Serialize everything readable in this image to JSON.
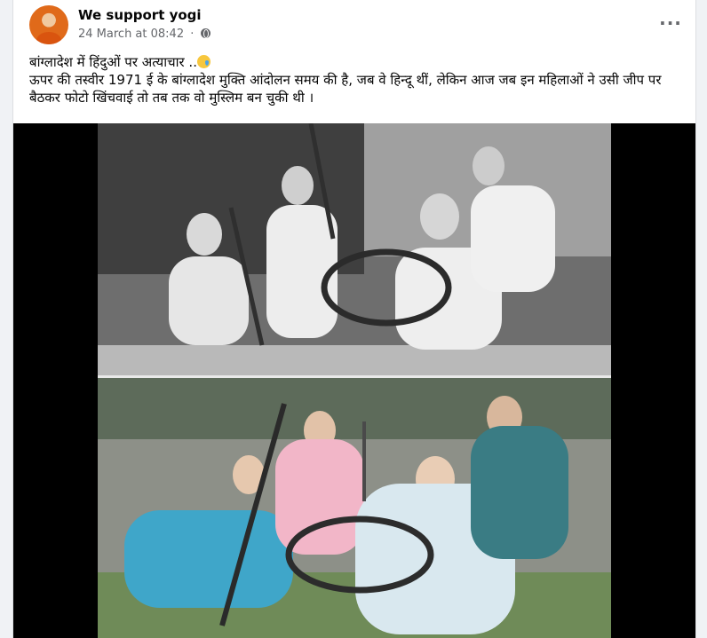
{
  "post": {
    "page_name": "We support yogi",
    "timestamp": "24 March at 08:42",
    "separator": "·",
    "privacy_icon": "globe-icon",
    "more_icon": "ellipsis-icon",
    "text_line1": "बांग्लादेश में हिंदुओं पर अत्याचार ..",
    "emoji": "crying-face-emoji",
    "text_line2": "ऊपर की तस्वीर 1971 ई के बांग्लादेश मुक्ति आंदोलन समय की है, जब वे हिन्दू थीं, लेकिन आज जब इन महिलाओं ने उसी जीप पर बैठकर फोटो खिंचवाई तो तब तक वो मुस्लिम बन चुकी थी ।"
  },
  "colors": {
    "background": "#f0f2f5",
    "card": "#ffffff",
    "text": "#050505",
    "meta": "#65676b",
    "media_background": "#000000"
  }
}
